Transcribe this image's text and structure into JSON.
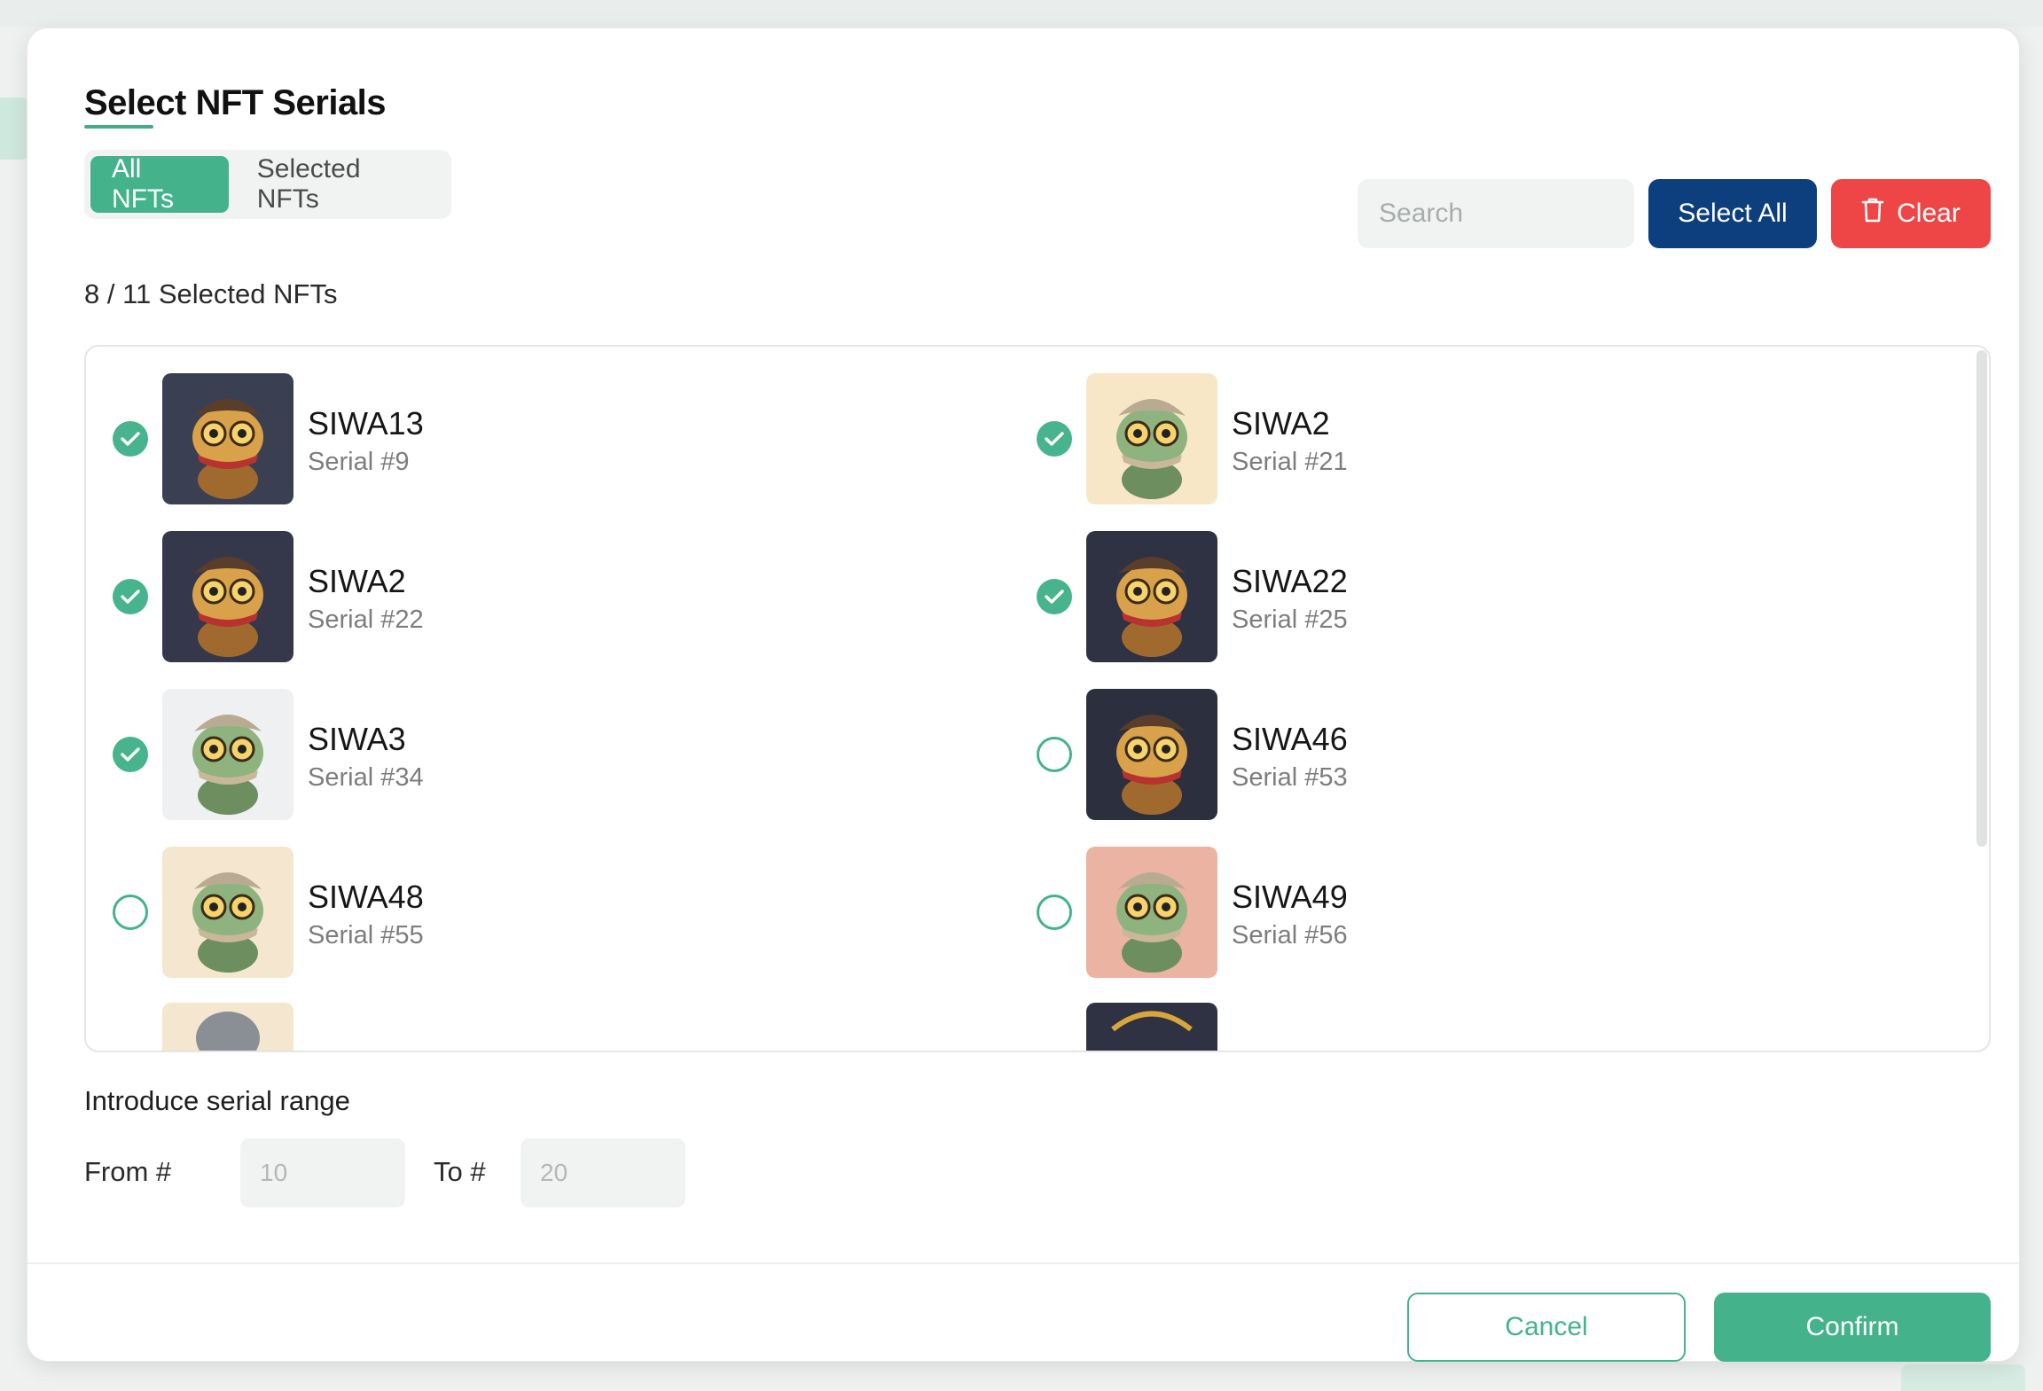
{
  "modal": {
    "title": "Select NFT Serials",
    "tabs": [
      {
        "label": "All NFTs",
        "active": true
      },
      {
        "label": "Selected NFTs",
        "active": false
      }
    ],
    "search_placeholder": "Search",
    "select_all_label": "Select All",
    "clear_label": "Clear",
    "selection_count": "8 / 11 Selected NFTs",
    "nfts": [
      {
        "name": "SIWA13",
        "serial": "Serial #9",
        "selected": true,
        "bg": "#3b3f52"
      },
      {
        "name": "SIWA2",
        "serial": "Serial #21",
        "selected": true,
        "bg": "#f7e7c7"
      },
      {
        "name": "SIWA2",
        "serial": "Serial #22",
        "selected": true,
        "bg": "#35384a"
      },
      {
        "name": "SIWA22",
        "serial": "Serial #25",
        "selected": true,
        "bg": "#2f3242"
      },
      {
        "name": "SIWA3",
        "serial": "Serial #34",
        "selected": true,
        "bg": "#eef0f1"
      },
      {
        "name": "SIWA46",
        "serial": "Serial #53",
        "selected": false,
        "bg": "#2c2f3e"
      },
      {
        "name": "SIWA48",
        "serial": "Serial #55",
        "selected": false,
        "bg": "#f4e6cf"
      },
      {
        "name": "SIWA49",
        "serial": "Serial #56",
        "selected": false,
        "bg": "#eab3a2"
      }
    ],
    "range": {
      "label": "Introduce serial range",
      "from_label": "From #",
      "to_label": "To #",
      "from_placeholder": "10",
      "to_placeholder": "20"
    },
    "cancel_label": "Cancel",
    "confirm_label": "Confirm"
  },
  "colors": {
    "accent": "#44b38c",
    "select_all": "#0d3f7e",
    "clear": "#ee4646"
  }
}
